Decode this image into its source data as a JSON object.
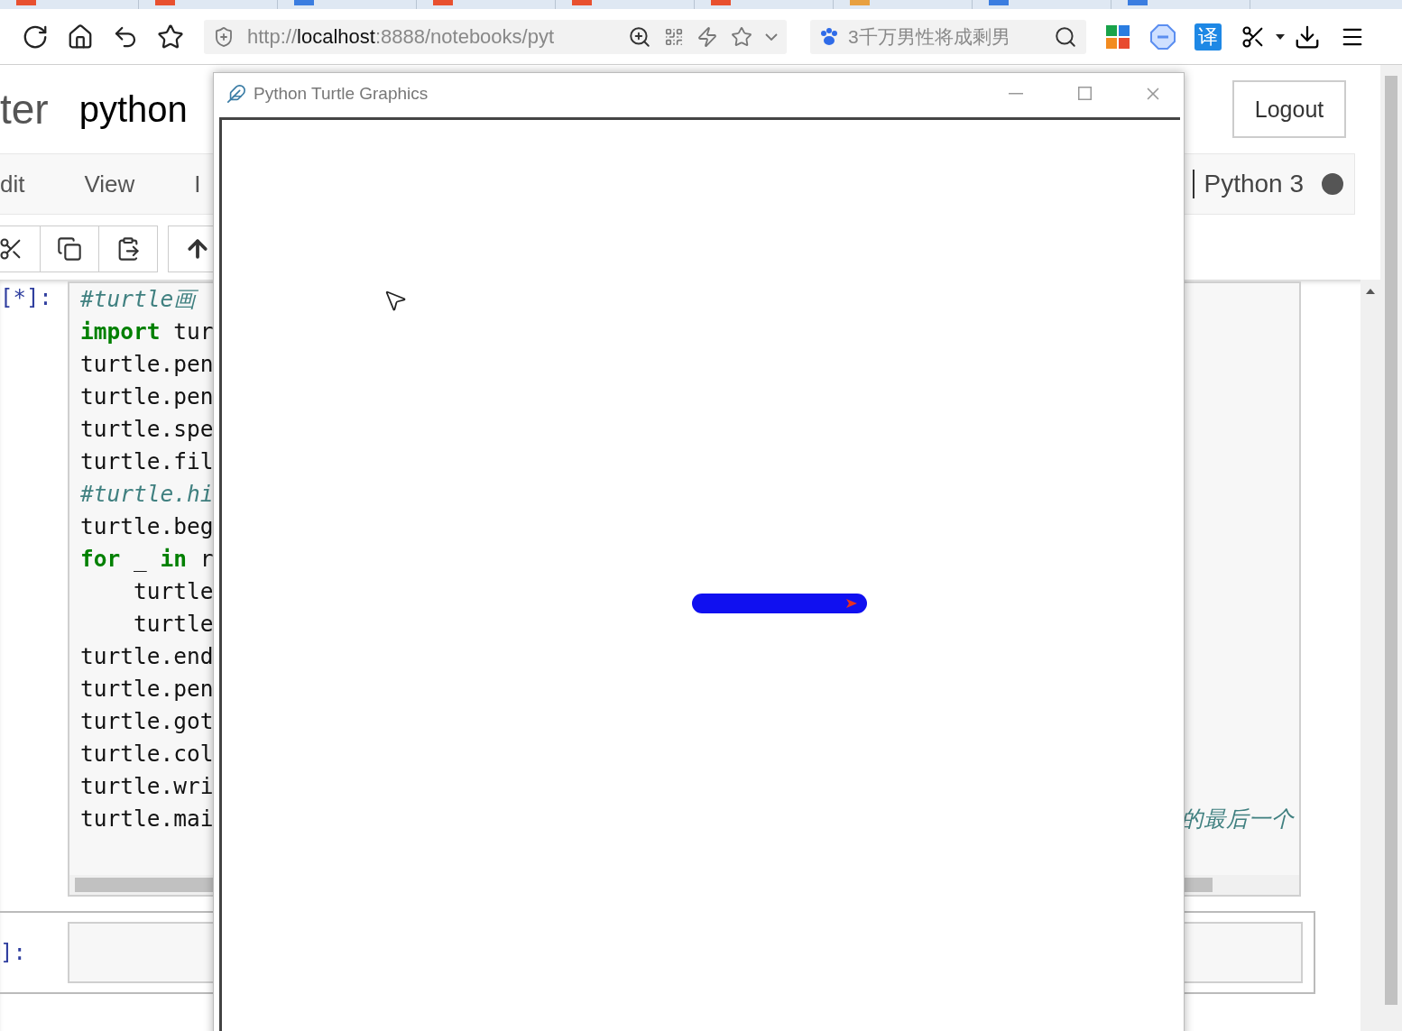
{
  "browser_tabs": [
    {
      "color": "#e8502f"
    },
    {
      "color": "#e8502f"
    },
    {
      "color": "#3b7de0"
    },
    {
      "color": "#e8502f"
    },
    {
      "color": "#e8502f"
    },
    {
      "color": "#e8502f"
    },
    {
      "color": "#e8a040"
    },
    {
      "color": "#3b7de0"
    },
    {
      "color": "#3b7de0"
    }
  ],
  "address_bar": {
    "scheme": "http://",
    "host": "localhost",
    "path": ":8888/notebooks/pyt"
  },
  "search_box": {
    "placeholder": "3千万男性将成剩男"
  },
  "translate_label": "译",
  "notebook": {
    "logo_text": "ter",
    "title": "python",
    "logout": "Logout",
    "menu": [
      "dit",
      "View",
      "I"
    ],
    "kernel_name": "Python 3",
    "kernel_busy": true,
    "cells": [
      {
        "prompt": "[*]:",
        "selected": false,
        "lines": [
          {
            "segments": [
              {
                "kind": "comment",
                "text": "#turtle画"
              }
            ]
          },
          {
            "segments": [
              {
                "kind": "keyword",
                "text": "import"
              },
              {
                "kind": "plain",
                "text": " tur"
              }
            ]
          },
          {
            "segments": [
              {
                "kind": "plain",
                "text": "turtle.pen"
              }
            ]
          },
          {
            "segments": [
              {
                "kind": "plain",
                "text": "turtle.pen"
              }
            ]
          },
          {
            "segments": [
              {
                "kind": "plain",
                "text": "turtle.spe"
              }
            ]
          },
          {
            "segments": [
              {
                "kind": "plain",
                "text": "turtle.fil"
              }
            ]
          },
          {
            "segments": [
              {
                "kind": "comment",
                "text": "#turtle.hi"
              }
            ]
          },
          {
            "segments": [
              {
                "kind": "plain",
                "text": "turtle.beg"
              }
            ]
          },
          {
            "segments": [
              {
                "kind": "keyword",
                "text": "for"
              },
              {
                "kind": "plain",
                "text": " _ "
              },
              {
                "kind": "keyword",
                "text": "in"
              },
              {
                "kind": "plain",
                "text": " r"
              }
            ]
          },
          {
            "segments": [
              {
                "kind": "plain",
                "text": "    turtle"
              }
            ]
          },
          {
            "segments": [
              {
                "kind": "plain",
                "text": "    turtle"
              }
            ]
          },
          {
            "segments": [
              {
                "kind": "plain",
                "text": "turtle.end"
              }
            ]
          },
          {
            "segments": [
              {
                "kind": "plain",
                "text": "turtle.pen"
              }
            ]
          },
          {
            "segments": [
              {
                "kind": "plain",
                "text": "turtle.got"
              }
            ]
          },
          {
            "segments": [
              {
                "kind": "plain",
                "text": "turtle.col"
              }
            ]
          },
          {
            "segments": [
              {
                "kind": "plain",
                "text": "turtle.wri"
              }
            ]
          },
          {
            "segments": [
              {
                "kind": "plain",
                "text": "turtle.mai"
              }
            ],
            "tail": {
              "kind": "comment",
              "text": "的最后一个"
            }
          }
        ]
      },
      {
        "prompt": "]:",
        "selected": true
      }
    ]
  },
  "turtle_window": {
    "title": "Python Turtle Graphics"
  }
}
